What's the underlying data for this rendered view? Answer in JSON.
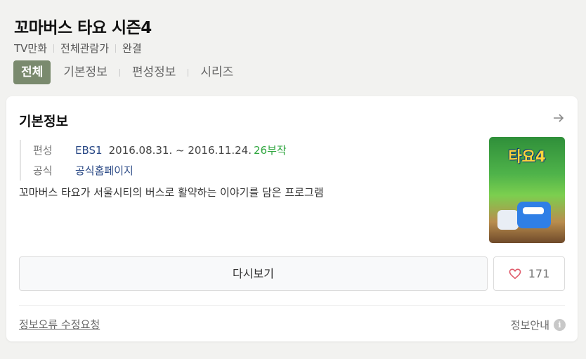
{
  "program": {
    "title": "꼬마버스 타요 시즌4",
    "meta": [
      "TV만화",
      "전체관람가",
      "완결"
    ]
  },
  "tabs": [
    {
      "label": "전체",
      "active": true
    },
    {
      "label": "기본정보",
      "active": false
    },
    {
      "label": "편성정보",
      "active": false
    },
    {
      "label": "시리즈",
      "active": false
    }
  ],
  "card": {
    "title": "기본정보",
    "schedule": {
      "label": "편성",
      "channel": "EBS1",
      "dates": "2016.08.31. ~ 2016.11.24.",
      "episodes": "26부작"
    },
    "official": {
      "label": "공식",
      "link": "공식홈페이지"
    },
    "description": "꼬마버스 타요가 서울시티의 버스로 활약하는 이야기를 담은 프로그램",
    "poster_text": "타요4",
    "replay_label": "다시보기",
    "like_count": "171",
    "report_label": "정보오류 수정요청",
    "info_guide_label": "정보안내",
    "info_icon_glyph": "i"
  },
  "colors": {
    "active_tab": "#7a8a6e",
    "link": "#2b4a86",
    "episodes": "#2fa63f",
    "heart": "#e05a6a"
  }
}
